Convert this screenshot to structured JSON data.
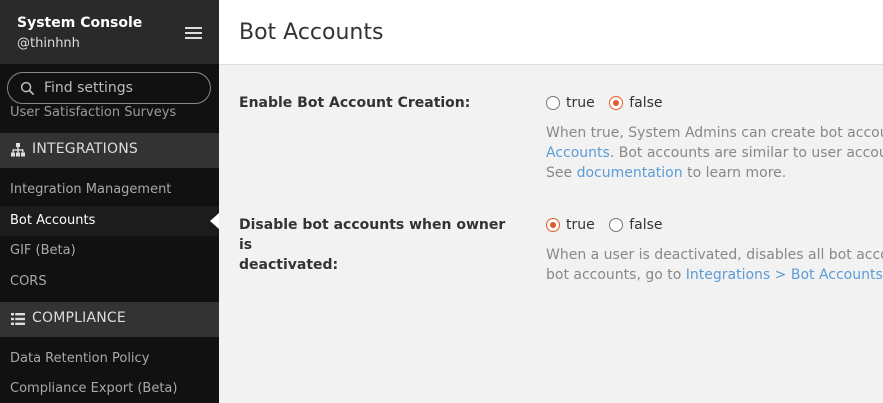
{
  "sidebar": {
    "title": "System Console",
    "username": "@thinhnh",
    "search_placeholder": "Find settings",
    "clipped_item": "User Satisfaction Surveys",
    "sections": [
      {
        "label": "INTEGRATIONS",
        "icon": "sitemap-icon",
        "items": [
          "Integration Management",
          "Bot Accounts",
          "GIF (Beta)",
          "CORS"
        ]
      },
      {
        "label": "COMPLIANCE",
        "icon": "list-icon",
        "items": [
          "Data Retention Policy",
          "Compliance Export (Beta)"
        ]
      }
    ],
    "active_item": "Bot Accounts"
  },
  "main": {
    "title": "Bot Accounts",
    "settings": [
      {
        "label": "Enable Bot Account Creation:",
        "options": [
          "true",
          "false"
        ],
        "selected": "false",
        "help_line1": "When true, System Admins can create bot accounts",
        "help_link1": "Accounts",
        "help_line2_rest": ". Bot accounts are similar to user accounts",
        "help_line3_pre": "See ",
        "help_link2": "documentation",
        "help_line3_post": " to learn more."
      },
      {
        "label_line1": "Disable bot accounts when owner is",
        "label_line2": "deactivated:",
        "options": [
          "true",
          "false"
        ],
        "selected": "true",
        "help_line1": "When a user is deactivated, disables all bot accounts",
        "help_line2_pre": "bot accounts, go to ",
        "help_link": "Integrations > Bot Accounts",
        "help_line2_post": "."
      }
    ]
  },
  "colors": {
    "accent": "#e05a2b",
    "link": "#5d9cd6",
    "sidebar_bg": "#111111"
  }
}
